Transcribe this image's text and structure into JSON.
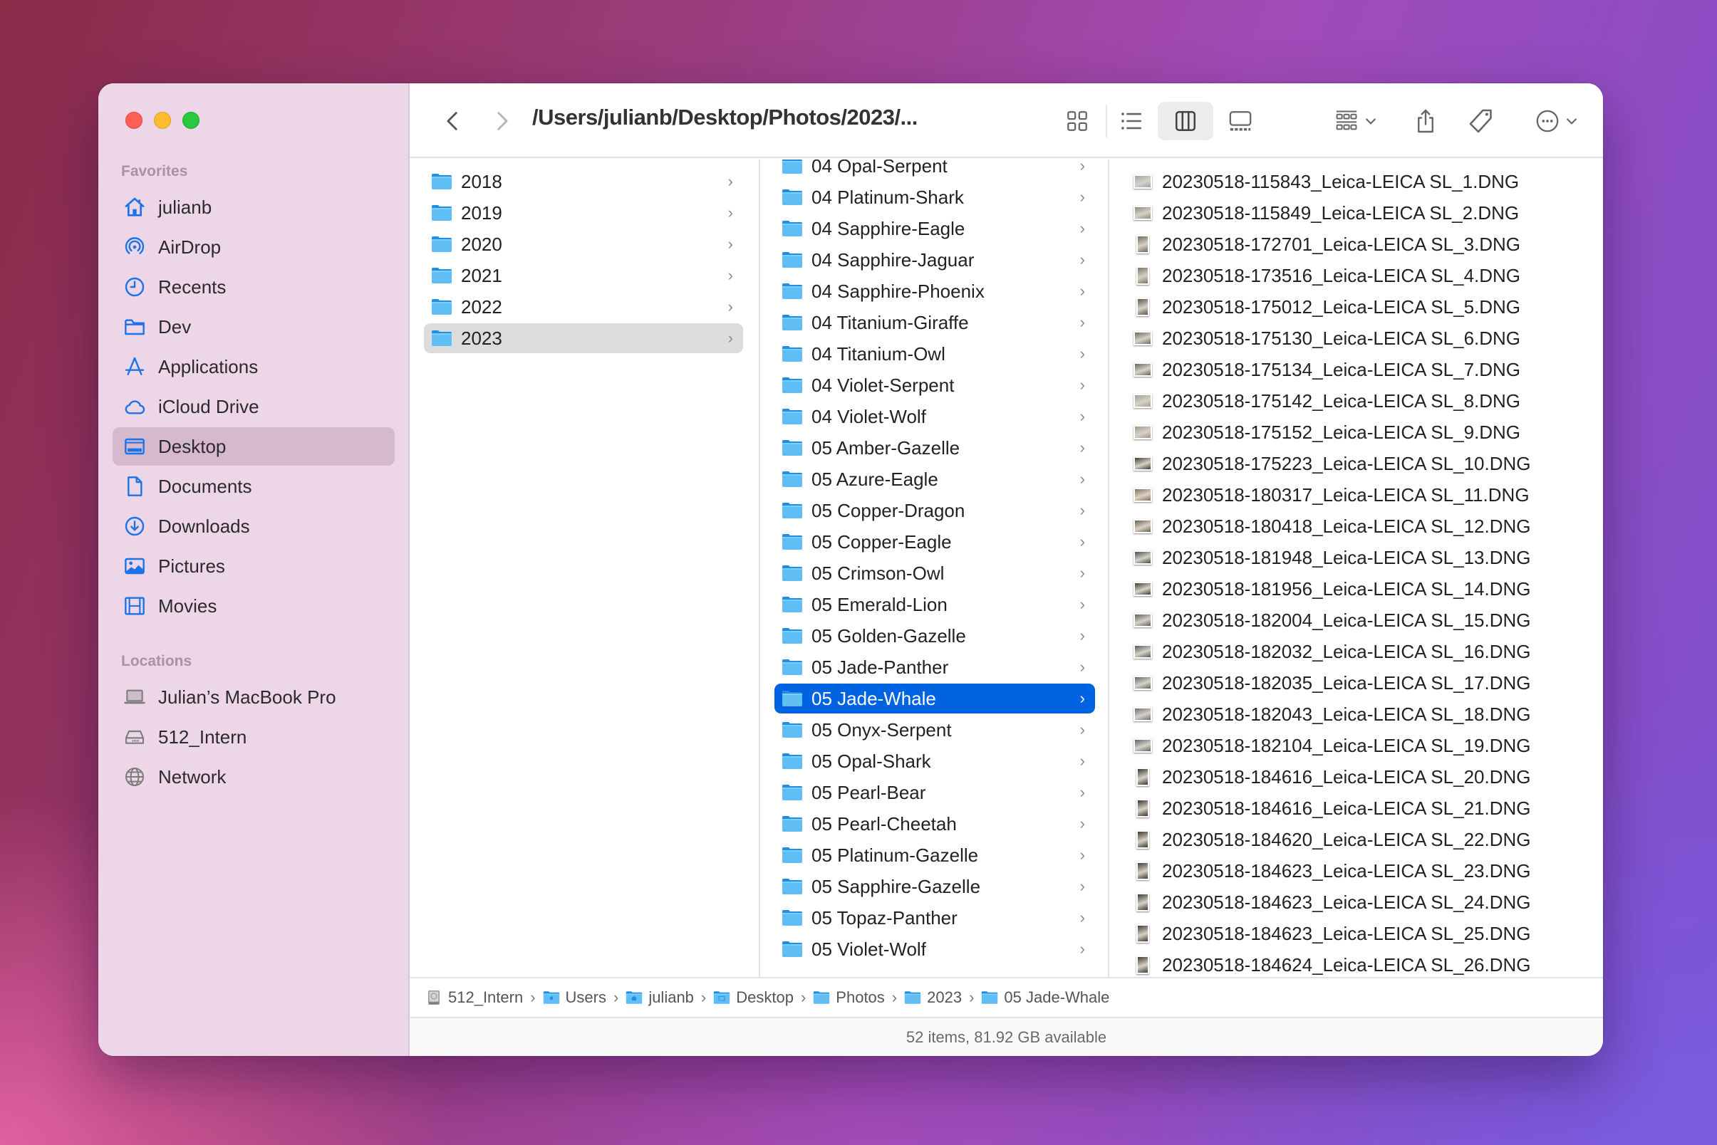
{
  "window": {
    "title_path": "/Users/julianb/Desktop/Photos/2023/..."
  },
  "sidebar": {
    "favorites_label": "Favorites",
    "favorites": [
      {
        "label": "julianb",
        "icon": "home-icon"
      },
      {
        "label": "AirDrop",
        "icon": "airdrop-icon"
      },
      {
        "label": "Recents",
        "icon": "clock-icon"
      },
      {
        "label": "Dev",
        "icon": "folder-icon"
      },
      {
        "label": "Applications",
        "icon": "applications-icon"
      },
      {
        "label": "iCloud Drive",
        "icon": "cloud-icon"
      },
      {
        "label": "Desktop",
        "icon": "desktop-icon",
        "active": true
      },
      {
        "label": "Documents",
        "icon": "document-icon"
      },
      {
        "label": "Downloads",
        "icon": "download-icon"
      },
      {
        "label": "Pictures",
        "icon": "photo-icon"
      },
      {
        "label": "Movies",
        "icon": "film-icon"
      }
    ],
    "locations_label": "Locations",
    "locations": [
      {
        "label": "Julian’s MacBook Pro",
        "icon": "laptop-icon"
      },
      {
        "label": "512_Intern",
        "icon": "drive-icon"
      },
      {
        "label": "Network",
        "icon": "globe-icon"
      }
    ]
  },
  "toolbar": {
    "back": "back-chevron-icon",
    "forward": "forward-chevron-icon",
    "views": [
      "icon-view",
      "list-view",
      "column-view",
      "gallery-view"
    ],
    "active_view": "column-view",
    "group": "group-icon",
    "share": "share-icon",
    "tag": "tag-icon",
    "more": "more-icon",
    "search": "search-icon"
  },
  "columns": {
    "years": {
      "items": [
        "2018",
        "2019",
        "2020",
        "2021",
        "2022",
        "2023"
      ],
      "selected": "2023"
    },
    "folders": {
      "items": [
        "04 Opal-Serpent",
        "04 Platinum-Shark",
        "04 Sapphire-Eagle",
        "04 Sapphire-Jaguar",
        "04 Sapphire-Phoenix",
        "04 Titanium-Giraffe",
        "04 Titanium-Owl",
        "04 Violet-Serpent",
        "04 Violet-Wolf",
        "05 Amber-Gazelle",
        "05 Azure-Eagle",
        "05 Copper-Dragon",
        "05 Copper-Eagle",
        "05 Crimson-Owl",
        "05 Emerald-Lion",
        "05 Golden-Gazelle",
        "05 Jade-Panther",
        "05 Jade-Whale",
        "05 Onyx-Serpent",
        "05 Opal-Shark",
        "05 Pearl-Bear",
        "05 Pearl-Cheetah",
        "05 Platinum-Gazelle",
        "05 Sapphire-Gazelle",
        "05 Topaz-Panther",
        "05 Violet-Wolf"
      ],
      "selected": "05 Jade-Whale"
    },
    "files": {
      "items": [
        {
          "name": "20230518-115843_Leica-LEICA SL_1.DNG",
          "orientation": "landscape",
          "tone": "#9aa6ad"
        },
        {
          "name": "20230518-115849_Leica-LEICA SL_2.DNG",
          "orientation": "landscape",
          "tone": "#8e8a80"
        },
        {
          "name": "20230518-172701_Leica-LEICA SL_3.DNG",
          "orientation": "portrait",
          "tone": "#6f6a5c"
        },
        {
          "name": "20230518-173516_Leica-LEICA SL_4.DNG",
          "orientation": "portrait",
          "tone": "#7b7466"
        },
        {
          "name": "20230518-175012_Leica-LEICA SL_5.DNG",
          "orientation": "portrait",
          "tone": "#5d5548"
        },
        {
          "name": "20230518-175130_Leica-LEICA SL_6.DNG",
          "orientation": "landscape",
          "tone": "#6c6a64"
        },
        {
          "name": "20230518-175134_Leica-LEICA SL_7.DNG",
          "orientation": "landscape",
          "tone": "#6a6760"
        },
        {
          "name": "20230518-175142_Leica-LEICA SL_8.DNG",
          "orientation": "landscape",
          "tone": "#a29e94"
        },
        {
          "name": "20230518-175152_Leica-LEICA SL_9.DNG",
          "orientation": "landscape",
          "tone": "#9c978c"
        },
        {
          "name": "20230518-175223_Leica-LEICA SL_10.DNG",
          "orientation": "landscape",
          "tone": "#3c3a36"
        },
        {
          "name": "20230518-180317_Leica-LEICA SL_11.DNG",
          "orientation": "landscape",
          "tone": "#8a6e58"
        },
        {
          "name": "20230518-180418_Leica-LEICA SL_12.DNG",
          "orientation": "landscape",
          "tone": "#6e6250"
        },
        {
          "name": "20230518-181948_Leica-LEICA SL_13.DNG",
          "orientation": "landscape",
          "tone": "#4a4a48"
        },
        {
          "name": "20230518-181956_Leica-LEICA SL_14.DNG",
          "orientation": "landscape",
          "tone": "#3e3e3c"
        },
        {
          "name": "20230518-182004_Leica-LEICA SL_15.DNG",
          "orientation": "landscape",
          "tone": "#5a5e62"
        },
        {
          "name": "20230518-182032_Leica-LEICA SL_16.DNG",
          "orientation": "landscape",
          "tone": "#54585c"
        },
        {
          "name": "20230518-182035_Leica-LEICA SL_17.DNG",
          "orientation": "landscape",
          "tone": "#62666a"
        },
        {
          "name": "20230518-182043_Leica-LEICA SL_18.DNG",
          "orientation": "landscape",
          "tone": "#6a6e72"
        },
        {
          "name": "20230518-182104_Leica-LEICA SL_19.DNG",
          "orientation": "landscape",
          "tone": "#5a6470"
        },
        {
          "name": "20230518-184616_Leica-LEICA SL_20.DNG",
          "orientation": "portrait",
          "tone": "#3a3630"
        },
        {
          "name": "20230518-184616_Leica-LEICA SL_21.DNG",
          "orientation": "portrait",
          "tone": "#3a3630"
        },
        {
          "name": "20230518-184620_Leica-LEICA SL_22.DNG",
          "orientation": "portrait",
          "tone": "#3c3832"
        },
        {
          "name": "20230518-184623_Leica-LEICA SL_23.DNG",
          "orientation": "portrait",
          "tone": "#3e3a34"
        },
        {
          "name": "20230518-184623_Leica-LEICA SL_24.DNG",
          "orientation": "portrait",
          "tone": "#3e3a34"
        },
        {
          "name": "20230518-184623_Leica-LEICA SL_25.DNG",
          "orientation": "portrait",
          "tone": "#403c36"
        },
        {
          "name": "20230518-184624_Leica-LEICA SL_26.DNG",
          "orientation": "portrait",
          "tone": "#403c36"
        }
      ]
    }
  },
  "pathbar": [
    {
      "label": "512_Intern",
      "icon": "drive-icon"
    },
    {
      "label": "Users",
      "icon": "users-folder-icon"
    },
    {
      "label": "julianb",
      "icon": "home-folder-icon"
    },
    {
      "label": "Desktop",
      "icon": "desktop-folder-icon"
    },
    {
      "label": "Photos",
      "icon": "folder-icon"
    },
    {
      "label": "2023",
      "icon": "folder-icon"
    },
    {
      "label": "05 Jade-Whale",
      "icon": "folder-icon"
    }
  ],
  "status": {
    "text": "52 items, 81.92 GB available"
  },
  "colors": {
    "accent": "#0063e1",
    "sidebar_icon": "#1a73e8",
    "sidebar_bg": "#ecd6e7",
    "folder_fill": "#62bff5",
    "folder_tab": "#1f8ee6"
  }
}
